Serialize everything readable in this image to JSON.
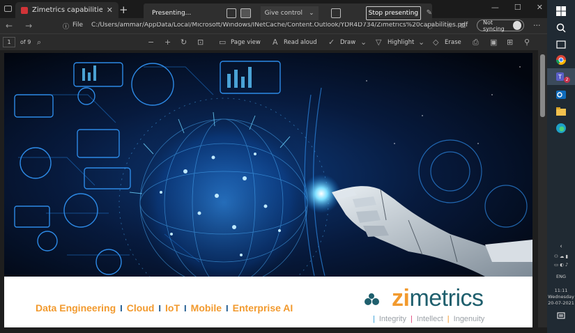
{
  "browser": {
    "tab_title": "Zimetrics capabilities.pdf",
    "tab_close": "✕",
    "new_tab": "+",
    "info_icon": "ⓘ",
    "file_label": "File",
    "url": "C:/Users/ammar/AppData/Local/Microsoft/Windows/INetCache/Content.Outlook/YDR4D734/Zimetrics%20capabilities.pdf",
    "sync_label": "Not syncing",
    "more": "···"
  },
  "presenting": {
    "label": "Presenting...",
    "give_control": "Give control",
    "stop": "Stop presenting"
  },
  "pdf_toolbar": {
    "page": "1",
    "of": "of 9",
    "page_view": "Page view",
    "read_aloud": "Read aloud",
    "draw": "Draw",
    "highlight": "Highlight",
    "erase": "Erase"
  },
  "slide": {
    "capabilities": [
      "Data Engineering",
      "Cloud",
      "IoT",
      "Mobile",
      "Enterprise AI"
    ],
    "separator": "I",
    "logo_zi": "zi",
    "logo_rest": "metrics",
    "tagline": [
      "Integrity",
      "Intellect",
      "Ingenuity"
    ],
    "tag_bar": "|"
  },
  "taskbar": {
    "lang": "ENG",
    "time": "11:11",
    "day": "Wednesday",
    "date": "20-07-2021",
    "teams_badge": "2"
  },
  "colors": {
    "accent_orange": "#f29a2e",
    "brand_teal": "#1f5f6d",
    "integrity": "#2e9bd6",
    "intellect": "#e0457b",
    "ingenuity": "#f29a2e"
  }
}
